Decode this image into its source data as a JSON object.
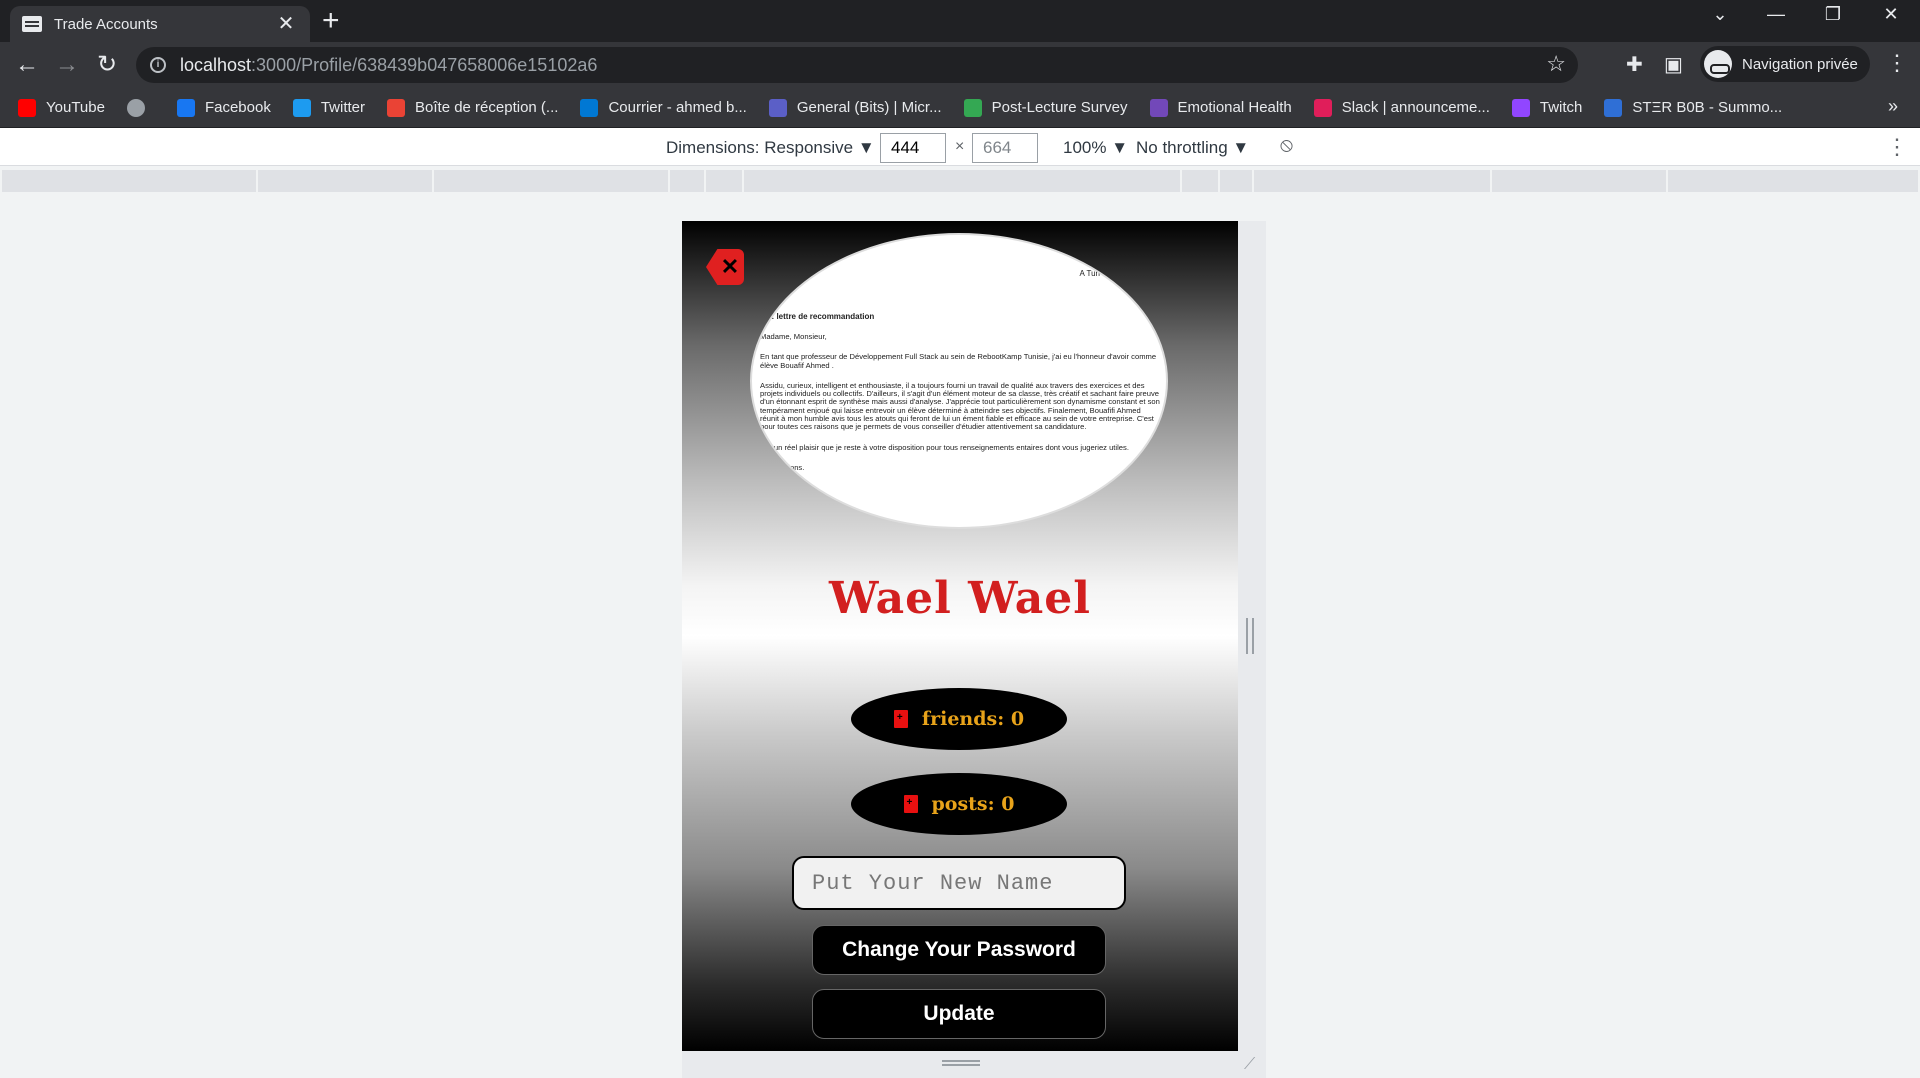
{
  "browser": {
    "tab_title": "Trade Accounts",
    "url_host": "localhost",
    "url_path": ":3000/Profile/638439b047658006e15102a6",
    "private_label": "Navigation privée"
  },
  "bookmarks": [
    {
      "label": "YouTube",
      "color": "#ff0000"
    },
    {
      "label": "",
      "color": "#9aa0a6"
    },
    {
      "label": "Facebook",
      "color": "#1877f2"
    },
    {
      "label": "Twitter",
      "color": "#1d9bf0"
    },
    {
      "label": "Boîte de réception (...",
      "color": "#ea4335"
    },
    {
      "label": "Courrier - ahmed b...",
      "color": "#0078d4"
    },
    {
      "label": "General (Bits) | Micr...",
      "color": "#5b5fc7"
    },
    {
      "label": "Post-Lecture Survey",
      "color": "#34a853"
    },
    {
      "label": "Emotional Health",
      "color": "#7248b9"
    },
    {
      "label": "Slack | announceme...",
      "color": "#e01e5a"
    },
    {
      "label": "Twitch",
      "color": "#9146ff"
    },
    {
      "label": "STΞR B0B - Summo...",
      "color": "#2f6fd6"
    }
  ],
  "devtools": {
    "dimensions_label": "Dimensions: Responsive",
    "width": "444",
    "height": "664",
    "zoom": "100%",
    "throttling": "No throttling"
  },
  "profile": {
    "name": "Wael Wael",
    "friends_label": "friends: 0",
    "posts_label": "posts: 0",
    "new_name_placeholder": "Put Your New Name",
    "change_password_label": "Change Your Password",
    "update_label": "Update",
    "avatar_doc": {
      "right_header": "A Tun",
      "subject": "jet : lettre de recommandation",
      "salutation": "Madame, Monsieur,",
      "para1": "En tant que professeur de Développement Full Stack au sein de RebootKamp Tunisie, j'ai eu l'honneur d'avoir comme élève Bouafif Ahmed .",
      "para2": "Assidu, curieux, intelligent et enthousiaste, il a toujours fourni un travail de qualité aux travers des exercices et des projets individuels ou collectifs. D'ailleurs, il s'agit d'un élément moteur de sa classe, très créatif et sachant faire preuve d'un étonnant esprit de synthèse mais aussi d'analyse. J'apprécie tout particulièrement son dynamisme constant et son tempérament enjoué qui laisse entrevoir un élève déterminé à atteindre ses objectifs. Finalement, Bouafifi Ahmed réunit à mon humble avis tous les atouts qui feront de lui un ément fiable et efficace au sein de votre entreprise. C'est pour toutes ces raisons que je permets de vous conseiller d'étudier attentivement sa candidature.",
      "para3": "vec un réel plaisir que je reste à votre disposition pour tous renseignements entaires dont vous jugeriez utiles.",
      "closing": "s salutations."
    }
  }
}
